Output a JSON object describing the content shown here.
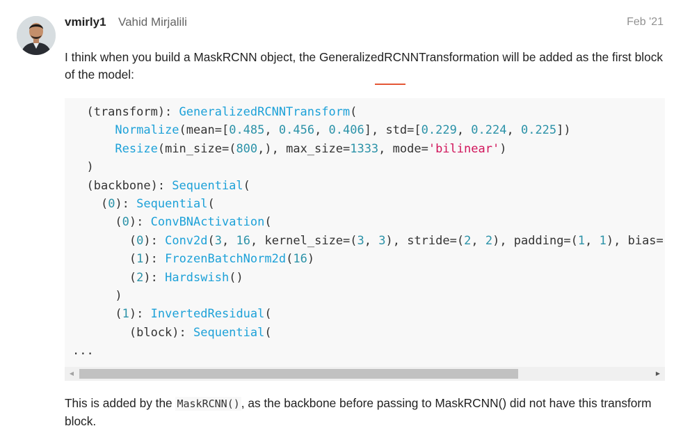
{
  "post": {
    "username": "vmirly1",
    "full_name": "Vahid Mirjalili",
    "date": "Feb '21",
    "paragraph1": "I think when you build a MaskRCNN object, the GeneralizedRCNNTransformation will be added as the first block of the model:",
    "code_lines": [
      [
        {
          "t": "  (transform): ",
          "c": "p"
        },
        {
          "t": "GeneralizedRCNNTransform",
          "c": "f"
        },
        {
          "t": "(",
          "c": "p"
        }
      ],
      [
        {
          "t": "      ",
          "c": "p"
        },
        {
          "t": "Normalize",
          "c": "f"
        },
        {
          "t": "(mean=[",
          "c": "p"
        },
        {
          "t": "0.485",
          "c": "n"
        },
        {
          "t": ", ",
          "c": "p"
        },
        {
          "t": "0.456",
          "c": "n"
        },
        {
          "t": ", ",
          "c": "p"
        },
        {
          "t": "0.406",
          "c": "n"
        },
        {
          "t": "], std=[",
          "c": "p"
        },
        {
          "t": "0.229",
          "c": "n"
        },
        {
          "t": ", ",
          "c": "p"
        },
        {
          "t": "0.224",
          "c": "n"
        },
        {
          "t": ", ",
          "c": "p"
        },
        {
          "t": "0.225",
          "c": "n"
        },
        {
          "t": "])",
          "c": "p"
        }
      ],
      [
        {
          "t": "      ",
          "c": "p"
        },
        {
          "t": "Resize",
          "c": "f"
        },
        {
          "t": "(min_size=(",
          "c": "p"
        },
        {
          "t": "800",
          "c": "n"
        },
        {
          "t": ",), max_size=",
          "c": "p"
        },
        {
          "t": "1333",
          "c": "n"
        },
        {
          "t": ", mode=",
          "c": "p"
        },
        {
          "t": "'bilinear'",
          "c": "s"
        },
        {
          "t": ")",
          "c": "p"
        }
      ],
      [
        {
          "t": "  )",
          "c": "p"
        }
      ],
      [
        {
          "t": "  (backbone): ",
          "c": "p"
        },
        {
          "t": "Sequential",
          "c": "f"
        },
        {
          "t": "(",
          "c": "p"
        }
      ],
      [
        {
          "t": "    (",
          "c": "p"
        },
        {
          "t": "0",
          "c": "n"
        },
        {
          "t": "): ",
          "c": "p"
        },
        {
          "t": "Sequential",
          "c": "f"
        },
        {
          "t": "(",
          "c": "p"
        }
      ],
      [
        {
          "t": "      (",
          "c": "p"
        },
        {
          "t": "0",
          "c": "n"
        },
        {
          "t": "): ",
          "c": "p"
        },
        {
          "t": "ConvBNActivation",
          "c": "f"
        },
        {
          "t": "(",
          "c": "p"
        }
      ],
      [
        {
          "t": "        (",
          "c": "p"
        },
        {
          "t": "0",
          "c": "n"
        },
        {
          "t": "): ",
          "c": "p"
        },
        {
          "t": "Conv2d",
          "c": "f"
        },
        {
          "t": "(",
          "c": "p"
        },
        {
          "t": "3",
          "c": "n"
        },
        {
          "t": ", ",
          "c": "p"
        },
        {
          "t": "16",
          "c": "n"
        },
        {
          "t": ", kernel_size=(",
          "c": "p"
        },
        {
          "t": "3",
          "c": "n"
        },
        {
          "t": ", ",
          "c": "p"
        },
        {
          "t": "3",
          "c": "n"
        },
        {
          "t": "), stride=(",
          "c": "p"
        },
        {
          "t": "2",
          "c": "n"
        },
        {
          "t": ", ",
          "c": "p"
        },
        {
          "t": "2",
          "c": "n"
        },
        {
          "t": "), padding=(",
          "c": "p"
        },
        {
          "t": "1",
          "c": "n"
        },
        {
          "t": ", ",
          "c": "p"
        },
        {
          "t": "1",
          "c": "n"
        },
        {
          "t": "), bias=",
          "c": "p"
        }
      ],
      [
        {
          "t": "        (",
          "c": "p"
        },
        {
          "t": "1",
          "c": "n"
        },
        {
          "t": "): ",
          "c": "p"
        },
        {
          "t": "FrozenBatchNorm2d",
          "c": "f"
        },
        {
          "t": "(",
          "c": "p"
        },
        {
          "t": "16",
          "c": "n"
        },
        {
          "t": ")",
          "c": "p"
        }
      ],
      [
        {
          "t": "        (",
          "c": "p"
        },
        {
          "t": "2",
          "c": "n"
        },
        {
          "t": "): ",
          "c": "p"
        },
        {
          "t": "Hardswish",
          "c": "f"
        },
        {
          "t": "()",
          "c": "p"
        }
      ],
      [
        {
          "t": "      )",
          "c": "p"
        }
      ],
      [
        {
          "t": "      (",
          "c": "p"
        },
        {
          "t": "1",
          "c": "n"
        },
        {
          "t": "): ",
          "c": "p"
        },
        {
          "t": "InvertedResidual",
          "c": "f"
        },
        {
          "t": "(",
          "c": "p"
        }
      ],
      [
        {
          "t": "        (block): ",
          "c": "p"
        },
        {
          "t": "Sequential",
          "c": "f"
        },
        {
          "t": "(",
          "c": "p"
        }
      ],
      [
        {
          "t": "...",
          "c": "p"
        }
      ]
    ],
    "paragraph2_before": "This is added by the ",
    "paragraph2_code": "MaskRCNN()",
    "paragraph2_after": ", as the backbone before passing to MaskRCNN() did not have this transform block."
  },
  "scrollbar": {
    "left_arrow": "◀",
    "right_arrow": "▶"
  },
  "colors": {
    "number": "#2b92a8",
    "function": "#1da1d8",
    "string": "#d1155b",
    "divider": "#e45735"
  },
  "icons": {
    "avatar": "user-avatar-photo"
  }
}
